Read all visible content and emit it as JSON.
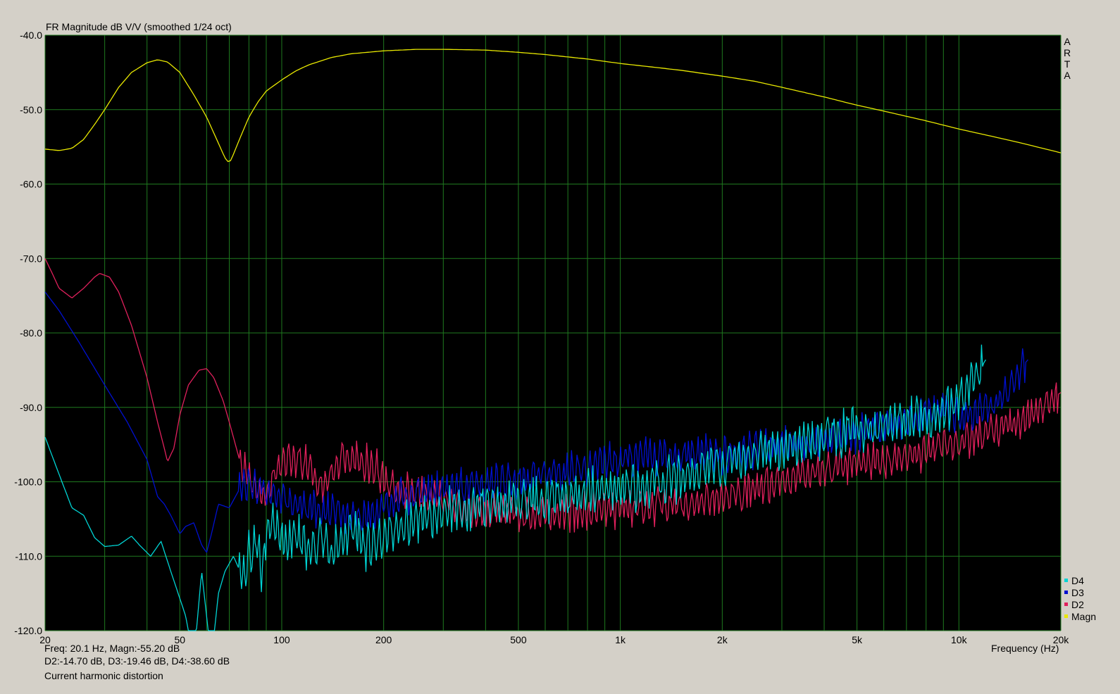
{
  "chart_data": {
    "type": "line",
    "title": "FR Magnitude dB V/V (smoothed 1/24 oct)",
    "xlabel": "Frequency (Hz)",
    "ylabel": "",
    "xscale": "log",
    "xlim": [
      20,
      20000
    ],
    "ylim": [
      -120,
      -40
    ],
    "grid": true,
    "legend_position": "bottom-right",
    "background": "#000000",
    "grid_color": "#1f7a1f",
    "y_ticks": [
      "-40.0",
      "-50.0",
      "-60.0",
      "-70.0",
      "-80.0",
      "-90.0",
      "-100.0",
      "-110.0",
      "-120.0"
    ],
    "x_ticks": [
      {
        "value": 20,
        "label": "20"
      },
      {
        "value": 50,
        "label": "50"
      },
      {
        "value": 100,
        "label": "100"
      },
      {
        "value": 200,
        "label": "200"
      },
      {
        "value": 500,
        "label": "500"
      },
      {
        "value": 1000,
        "label": "1k"
      },
      {
        "value": 2000,
        "label": "2k"
      },
      {
        "value": 5000,
        "label": "5k"
      },
      {
        "value": 10000,
        "label": "10k"
      },
      {
        "value": 20000,
        "label": "20k"
      }
    ],
    "series": [
      {
        "name": "D4",
        "color": "#00d4d4",
        "jitter": 3.0,
        "points": [
          [
            20,
            -94
          ],
          [
            22,
            -99
          ],
          [
            24,
            -103.5
          ],
          [
            26,
            -104.5
          ],
          [
            28,
            -107.5
          ],
          [
            30,
            -108.7
          ],
          [
            33,
            -108.5
          ],
          [
            36,
            -107.3
          ],
          [
            38,
            -108.5
          ],
          [
            41,
            -110
          ],
          [
            44,
            -108
          ],
          [
            47,
            -112
          ],
          [
            52,
            -118
          ],
          [
            55,
            -124
          ],
          [
            58,
            -112
          ],
          [
            62,
            -124
          ],
          [
            65,
            -115
          ],
          [
            68,
            -112
          ],
          [
            72,
            -110
          ],
          [
            77,
            -113
          ],
          [
            80,
            -110
          ],
          [
            84,
            -107.5
          ],
          [
            87,
            -112
          ],
          [
            92,
            -105
          ],
          [
            100,
            -108
          ],
          [
            110,
            -107
          ],
          [
            120,
            -109
          ],
          [
            130,
            -107.5
          ],
          [
            140,
            -110
          ],
          [
            150,
            -108
          ],
          [
            160,
            -106
          ],
          [
            175,
            -109
          ],
          [
            190,
            -108
          ],
          [
            200,
            -107
          ],
          [
            230,
            -106
          ],
          [
            260,
            -105
          ],
          [
            300,
            -104
          ],
          [
            350,
            -103.5
          ],
          [
            400,
            -103
          ],
          [
            450,
            -103
          ],
          [
            500,
            -102.5
          ],
          [
            600,
            -102.5
          ],
          [
            700,
            -102
          ],
          [
            800,
            -101.5
          ],
          [
            900,
            -101
          ],
          [
            1000,
            -101
          ],
          [
            1200,
            -100.5
          ],
          [
            1500,
            -99.5
          ],
          [
            1800,
            -98
          ],
          [
            2000,
            -97.5
          ],
          [
            2500,
            -96.5
          ],
          [
            3000,
            -95.5
          ],
          [
            3500,
            -95
          ],
          [
            4000,
            -94
          ],
          [
            5000,
            -93
          ],
          [
            6000,
            -92.5
          ],
          [
            7000,
            -92
          ],
          [
            8000,
            -91.5
          ],
          [
            9000,
            -90.5
          ],
          [
            10000,
            -89
          ],
          [
            11000,
            -86.5
          ],
          [
            12000,
            -83.6
          ]
        ]
      },
      {
        "name": "D3",
        "color": "#0010d0",
        "jitter": 2.4,
        "points": [
          [
            20,
            -74.5
          ],
          [
            22,
            -77
          ],
          [
            25,
            -81
          ],
          [
            30,
            -87
          ],
          [
            35,
            -92
          ],
          [
            40,
            -97
          ],
          [
            43,
            -102
          ],
          [
            45,
            -103
          ],
          [
            47,
            -104.5
          ],
          [
            50,
            -107
          ],
          [
            52,
            -106
          ],
          [
            55,
            -105.5
          ],
          [
            58,
            -108.5
          ],
          [
            60,
            -109.5
          ],
          [
            62,
            -107
          ],
          [
            65,
            -103
          ],
          [
            70,
            -103.5
          ],
          [
            75,
            -101
          ],
          [
            80,
            -100
          ],
          [
            85,
            -100.5
          ],
          [
            90,
            -101
          ],
          [
            100,
            -102
          ],
          [
            110,
            -103
          ],
          [
            130,
            -104
          ],
          [
            150,
            -104
          ],
          [
            170,
            -105
          ],
          [
            190,
            -104
          ],
          [
            200,
            -103
          ],
          [
            230,
            -102
          ],
          [
            260,
            -101.5
          ],
          [
            300,
            -101
          ],
          [
            350,
            -100.5
          ],
          [
            400,
            -100.5
          ],
          [
            450,
            -100
          ],
          [
            500,
            -100
          ],
          [
            550,
            -99.5
          ],
          [
            600,
            -99
          ],
          [
            700,
            -98.5
          ],
          [
            800,
            -98
          ],
          [
            900,
            -97.5
          ],
          [
            1000,
            -97
          ],
          [
            1200,
            -96.5
          ],
          [
            1500,
            -96.5
          ],
          [
            1800,
            -96
          ],
          [
            2000,
            -96.5
          ],
          [
            2500,
            -95.5
          ],
          [
            3000,
            -95
          ],
          [
            3500,
            -95
          ],
          [
            4000,
            -94.5
          ],
          [
            5000,
            -93.5
          ],
          [
            6000,
            -92.5
          ],
          [
            7000,
            -92
          ],
          [
            8000,
            -91
          ],
          [
            9000,
            -90.5
          ],
          [
            10000,
            -91
          ],
          [
            11000,
            -91
          ],
          [
            12000,
            -90
          ],
          [
            13000,
            -89
          ],
          [
            14000,
            -87.5
          ],
          [
            15000,
            -85
          ],
          [
            16000,
            -83.6
          ]
        ]
      },
      {
        "name": "D2",
        "color": "#e0205c",
        "jitter": 2.4,
        "points": [
          [
            20,
            -70
          ],
          [
            21,
            -72
          ],
          [
            22,
            -74
          ],
          [
            24,
            -75.3
          ],
          [
            26,
            -74
          ],
          [
            28,
            -72.5
          ],
          [
            29,
            -72
          ],
          [
            31,
            -72.5
          ],
          [
            33,
            -74.5
          ],
          [
            36,
            -79
          ],
          [
            40,
            -86
          ],
          [
            43,
            -92
          ],
          [
            45,
            -95.5
          ],
          [
            46,
            -97.3
          ],
          [
            48,
            -95.5
          ],
          [
            50,
            -91
          ],
          [
            53,
            -87
          ],
          [
            57,
            -85
          ],
          [
            60,
            -84.8
          ],
          [
            63,
            -86
          ],
          [
            67,
            -89
          ],
          [
            70,
            -92
          ],
          [
            75,
            -97
          ],
          [
            80,
            -99.5
          ],
          [
            85,
            -101.5
          ],
          [
            88,
            -102
          ],
          [
            92,
            -101
          ],
          [
            95,
            -99
          ],
          [
            100,
            -97
          ],
          [
            110,
            -97
          ],
          [
            120,
            -97.5
          ],
          [
            130,
            -101
          ],
          [
            150,
            -97
          ],
          [
            170,
            -97
          ],
          [
            190,
            -98
          ],
          [
            200,
            -100
          ],
          [
            220,
            -101
          ],
          [
            250,
            -101.5
          ],
          [
            300,
            -102.5
          ],
          [
            350,
            -104
          ],
          [
            400,
            -104
          ],
          [
            450,
            -104
          ],
          [
            500,
            -104.5
          ],
          [
            600,
            -104.5
          ],
          [
            700,
            -104
          ],
          [
            800,
            -104
          ],
          [
            900,
            -104
          ],
          [
            1000,
            -103.5
          ],
          [
            1200,
            -103.5
          ],
          [
            1500,
            -103
          ],
          [
            1800,
            -102.5
          ],
          [
            2000,
            -102
          ],
          [
            2500,
            -101
          ],
          [
            3000,
            -100
          ],
          [
            3500,
            -99
          ],
          [
            4000,
            -98.5
          ],
          [
            5000,
            -97.5
          ],
          [
            6000,
            -97
          ],
          [
            7000,
            -96.5
          ],
          [
            8000,
            -96
          ],
          [
            9000,
            -95.5
          ],
          [
            10000,
            -95
          ],
          [
            11000,
            -94
          ],
          [
            12000,
            -93
          ],
          [
            14000,
            -92.5
          ],
          [
            16000,
            -91.5
          ],
          [
            18000,
            -89.5
          ],
          [
            20000,
            -88
          ]
        ]
      },
      {
        "name": "Magn",
        "color": "#e8e800",
        "jitter": 0,
        "points": [
          [
            20,
            -55.3
          ],
          [
            22,
            -55.5
          ],
          [
            24,
            -55.2
          ],
          [
            26,
            -54
          ],
          [
            28,
            -52
          ],
          [
            30,
            -50
          ],
          [
            33,
            -47
          ],
          [
            36,
            -45
          ],
          [
            40,
            -43.7
          ],
          [
            43,
            -43.3
          ],
          [
            46,
            -43.6
          ],
          [
            50,
            -45
          ],
          [
            55,
            -48
          ],
          [
            60,
            -51
          ],
          [
            65,
            -54.5
          ],
          [
            68,
            -56.5
          ],
          [
            70,
            -57.2
          ],
          [
            72,
            -56
          ],
          [
            75,
            -54
          ],
          [
            80,
            -51
          ],
          [
            85,
            -49
          ],
          [
            90,
            -47.5
          ],
          [
            100,
            -46
          ],
          [
            110,
            -44.8
          ],
          [
            120,
            -44
          ],
          [
            140,
            -43
          ],
          [
            160,
            -42.5
          ],
          [
            200,
            -42.1
          ],
          [
            250,
            -41.9
          ],
          [
            300,
            -41.9
          ],
          [
            400,
            -42
          ],
          [
            500,
            -42.3
          ],
          [
            600,
            -42.6
          ],
          [
            800,
            -43.2
          ],
          [
            1000,
            -43.8
          ],
          [
            1200,
            -44.2
          ],
          [
            1500,
            -44.7
          ],
          [
            2000,
            -45.5
          ],
          [
            2500,
            -46.2
          ],
          [
            3000,
            -47
          ],
          [
            4000,
            -48.3
          ],
          [
            5000,
            -49.4
          ],
          [
            6000,
            -50.2
          ],
          [
            8000,
            -51.5
          ],
          [
            10000,
            -52.6
          ],
          [
            12000,
            -53.4
          ],
          [
            15000,
            -54.4
          ],
          [
            20000,
            -55.8
          ]
        ]
      }
    ]
  },
  "brand_text": "ARTA",
  "readout": {
    "freq_line": "Freq: 20.1 Hz, Magn:-55.20 dB",
    "dist_line": "D2:-14.70 dB, D3:-19.46 dB, D4:-38.60 dB",
    "mode_line": "Current harmonic distortion"
  }
}
